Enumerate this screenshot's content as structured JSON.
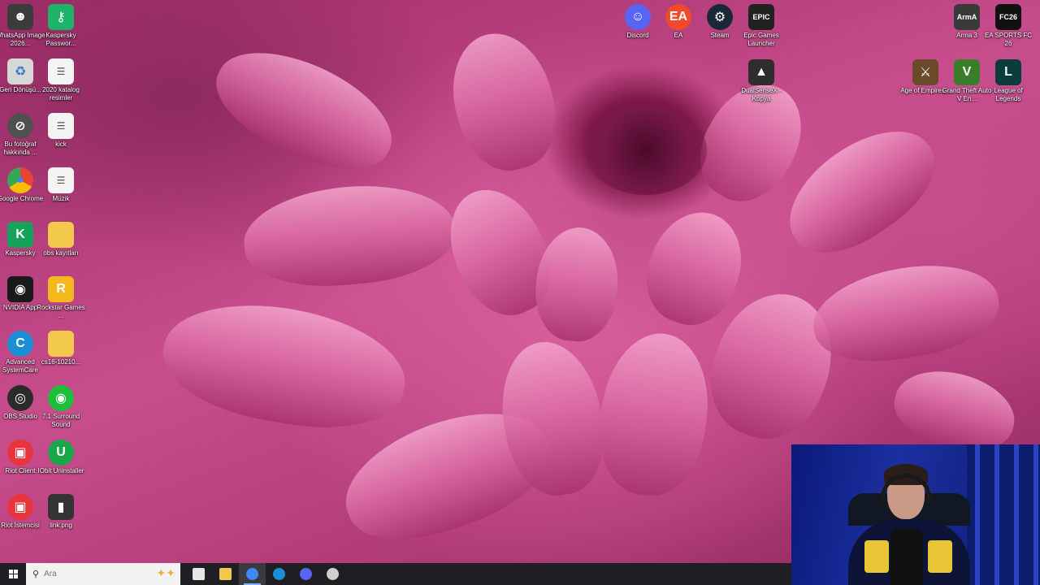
{
  "desktop": {
    "left_icons": [
      {
        "label": "WhatsApp Image 2026...",
        "icon": "photo-thumbnail-icon",
        "color": "#3c3c3c"
      },
      {
        "label": "Kaspersky Passwor...",
        "icon": "kaspersky-password-icon",
        "color": "#1fb36a"
      },
      {
        "label": "Geri Dönüşü...",
        "icon": "recycle-bin-icon",
        "color": "#d7d7d7"
      },
      {
        "label": "2020 katalog resimler",
        "icon": "document-icon",
        "color": "#f4f4f4"
      },
      {
        "label": "Bu fotoğraf hakkında ...",
        "icon": "info-camera-icon",
        "color": "#505050"
      },
      {
        "label": "kick",
        "icon": "document-icon",
        "color": "#f4f4f4"
      },
      {
        "label": "Google Chrome",
        "icon": "chrome-icon",
        "color": "#4285f4"
      },
      {
        "label": "Müzik",
        "icon": "document-icon",
        "color": "#f4f4f4"
      },
      {
        "label": "Kaspersky",
        "icon": "kaspersky-icon",
        "color": "#15a35c"
      },
      {
        "label": "obs kayıtları",
        "icon": "folder-icon",
        "color": "#f2c94c"
      },
      {
        "label": "NVIDIA App",
        "icon": "nvidia-icon",
        "color": "#1a1a1a"
      },
      {
        "label": "Rockstar Games ...",
        "icon": "rockstar-icon",
        "color": "#f3b81c"
      },
      {
        "label": "Advanced SystemCare",
        "icon": "systemcare-icon",
        "color": "#1b8fd6"
      },
      {
        "label": "cs16-10210...",
        "icon": "folder-icon",
        "color": "#f2c94c"
      },
      {
        "label": "OBS Studio",
        "icon": "obs-icon",
        "color": "#2b2b2b"
      },
      {
        "label": "7.1 Surround Sound",
        "icon": "surround-sound-icon",
        "color": "#1dbf3a"
      },
      {
        "label": "Riot Client",
        "icon": "riot-icon",
        "color": "#e8343d"
      },
      {
        "label": "IObit Uninstaller",
        "icon": "iobit-icon",
        "color": "#18a84a"
      },
      {
        "label": "Riot İstemcisi",
        "icon": "riot-icon",
        "color": "#e8343d"
      },
      {
        "label": "link.png",
        "icon": "image-file-icon",
        "color": "#333333"
      }
    ],
    "top_icons": [
      {
        "label": "Discord",
        "icon": "discord-icon",
        "color": "#5865f2"
      },
      {
        "label": "EA",
        "icon": "ea-icon",
        "color": "#ef4a2a"
      },
      {
        "label": "Steam",
        "icon": "steam-icon",
        "color": "#1b2838"
      },
      {
        "label": "Epic Games Launcher",
        "icon": "epic-games-icon",
        "color": "#222222"
      },
      {
        "label": "DualSenseX - Kopya",
        "icon": "dualsensex-icon",
        "color": "#2d2d2d"
      }
    ],
    "right_icons": [
      {
        "label": "Arma 3",
        "icon": "arma-icon",
        "color": "#3a3a3a"
      },
      {
        "label": "EA SPORTS FC 26",
        "icon": "fc26-icon",
        "color": "#111111"
      },
      {
        "label": "Age of Empires...",
        "icon": "age-of-empires-icon",
        "color": "#6b4a2c"
      },
      {
        "label": "Grand Theft Auto V En...",
        "icon": "gta-v-icon",
        "color": "#3a7d2a"
      },
      {
        "label": "League of Legends",
        "icon": "league-icon",
        "color": "#0a3c3c"
      }
    ],
    "glyphs": {
      "kaspersky": "K",
      "rockstar": "R",
      "systemcare": "C",
      "iobit": "U",
      "ea": "EA",
      "epic": "EPIC",
      "arma": "ArmA",
      "fc26": "FC26",
      "gta": "V",
      "league": "L"
    }
  },
  "taskbar": {
    "search_placeholder": "Ara",
    "search_icon": "search-icon",
    "apps": [
      {
        "name": "task-view-icon",
        "color": "#e6e6e6"
      },
      {
        "name": "file-explorer-icon",
        "color": "#f2c94c"
      },
      {
        "name": "chrome-icon",
        "color": "#4285f4",
        "active": true
      },
      {
        "name": "systemcare-icon",
        "color": "#1b8fd6"
      },
      {
        "name": "discord-taskbar-icon",
        "color": "#5865f2"
      },
      {
        "name": "obs-taskbar-icon",
        "color": "#cfcfcf"
      }
    ]
  }
}
